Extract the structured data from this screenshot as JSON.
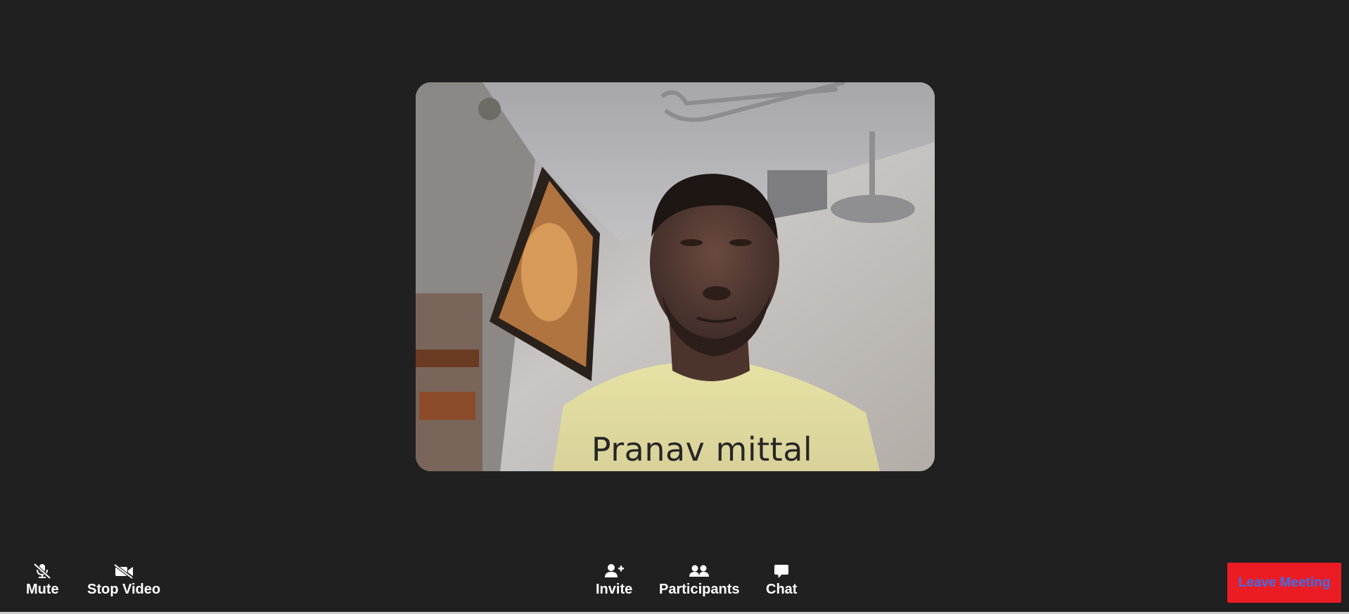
{
  "participant": {
    "name": "Pranav mittal"
  },
  "toolbar": {
    "mute_label": "Mute",
    "stop_video_label": "Stop Video",
    "invite_label": "Invite",
    "participants_label": "Participants",
    "chat_label": "Chat",
    "leave_label": "Leave Meeting"
  },
  "icons": {
    "mute": "microphone-slash-icon",
    "stop_video": "video-slash-icon",
    "invite": "user-plus-icon",
    "participants": "users-icon",
    "chat": "chat-bubble-icon"
  },
  "colors": {
    "background": "#202020",
    "leave_button_bg": "#ec1c24",
    "leave_button_text": "#3f6ee6",
    "toolbar_text": "#ffffff",
    "name_overlay_text": "#262626"
  }
}
